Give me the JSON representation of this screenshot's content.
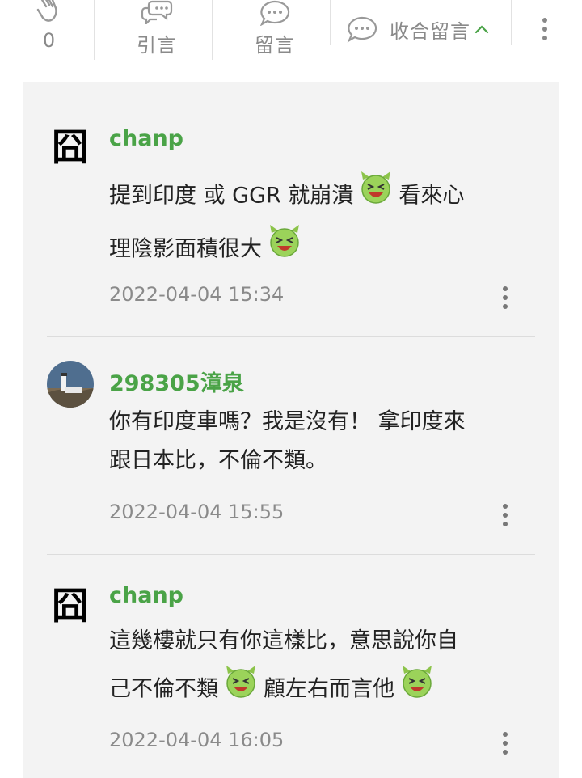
{
  "toolbar": {
    "like_count": "0",
    "quote_label": "引言",
    "comment_label": "留言",
    "collapse_label": "收合留言"
  },
  "comments": [
    {
      "username": "chanp",
      "avatar_glyph": "囧",
      "lines": [
        "提到印度 或 GGR 就崩潰",
        "看來心",
        "理陰影面積很大"
      ],
      "timestamp": "2022-04-04 15:34"
    },
    {
      "username": "298305漳泉",
      "lines": [
        "你有印度車嗎？我是沒有！ 拿印度來",
        "跟日本比，不倫不類。"
      ],
      "timestamp": "2022-04-04 15:55"
    },
    {
      "username": "chanp",
      "avatar_glyph": "囧",
      "lines": [
        "這幾樓就只有你這樣比，意思說你自",
        "己不倫不類",
        "顧左右而言他"
      ],
      "timestamp": "2022-04-04 16:05"
    }
  ],
  "colors": {
    "username_green": "#4aa347",
    "emoji_green": "#9bd35a",
    "panel_bg": "#f3f3f3"
  },
  "icons": {
    "like": "clap-hands-icon",
    "quote": "quote-chat-bubbles-icon",
    "comment": "comment-bubble-icon",
    "collapse": "comment-bubble-icon",
    "emoji": "laughing-devil-emoji-icon"
  }
}
